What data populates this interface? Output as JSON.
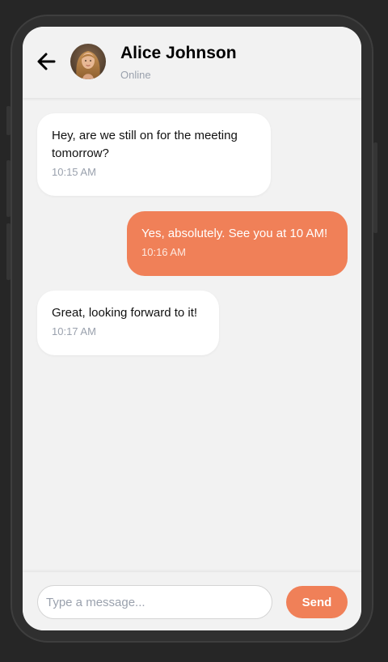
{
  "header": {
    "back_icon": "arrow-left-icon",
    "contact_name": "Alice Johnson",
    "status": "Online"
  },
  "messages": [
    {
      "direction": "incoming",
      "text": "Hey, are we still on for the meeting tomorrow?",
      "time": "10:15 AM"
    },
    {
      "direction": "outgoing",
      "text": "Yes, absolutely. See you at 10 AM!",
      "time": "10:16 AM"
    },
    {
      "direction": "incoming",
      "text": "Great, looking forward to it!",
      "time": "10:17 AM"
    }
  ],
  "composer": {
    "placeholder": "Type a message...",
    "value": "",
    "send_label": "Send"
  },
  "colors": {
    "accent": "#f08058",
    "background": "#f2f2f2",
    "incoming_bubble": "#ffffff",
    "muted_text": "#9aa1ad"
  }
}
